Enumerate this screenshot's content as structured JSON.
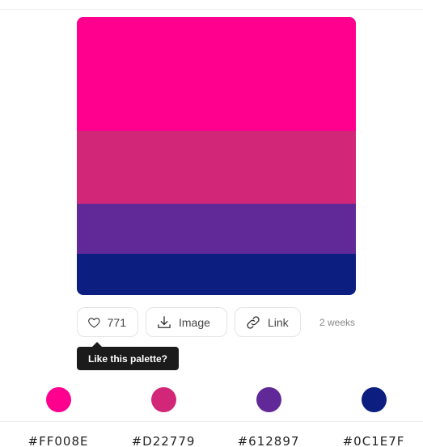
{
  "palette": {
    "colors": [
      {
        "hex_label": "#FF008E",
        "color": "#FF008E"
      },
      {
        "hex_label": "#D22779",
        "color": "#D22779"
      },
      {
        "hex_label": "#612897",
        "color": "#612897"
      },
      {
        "hex_label": "#0C1E7F",
        "color": "#0C1E7F"
      }
    ]
  },
  "actions": {
    "like_count": "771",
    "image_label": "Image",
    "link_label": "Link",
    "age": "2 weeks"
  },
  "tooltip": {
    "text": "Like this palette?"
  },
  "icons": {
    "like": "heart-icon",
    "image": "download-icon",
    "link": "link-icon"
  }
}
